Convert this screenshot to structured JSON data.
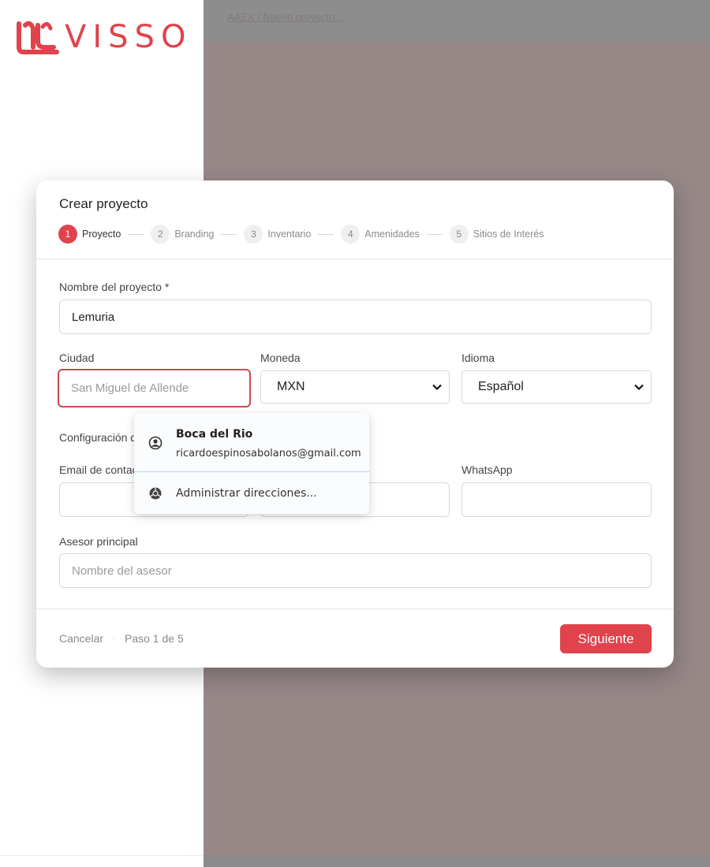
{
  "brand": {
    "name": "VISSO",
    "color": "#e0434b"
  },
  "background": {
    "breadcrumb": "AAEX / Nuevo proyecto..."
  },
  "modal": {
    "title": "Crear proyecto",
    "steps": [
      {
        "num": "1",
        "label": "Proyecto",
        "active": true
      },
      {
        "num": "2",
        "label": "Branding"
      },
      {
        "num": "3",
        "label": "Inventario"
      },
      {
        "num": "4",
        "label": "Amenidades"
      },
      {
        "num": "5",
        "label": "Sitios de Interés"
      }
    ],
    "fields": {
      "project_name": {
        "label": "Nombre del proyecto *",
        "value": "Lemuria"
      },
      "city": {
        "label": "Ciudad",
        "placeholder": "San Miguel de Allende",
        "value": ""
      },
      "currency": {
        "label": "Moneda",
        "value": "MXN"
      },
      "language": {
        "label": "Idioma",
        "value": "Español"
      },
      "config_section": {
        "label": "Configuración de"
      },
      "contact_email": {
        "label": "Email de contacto",
        "value": ""
      },
      "phone": {
        "value": ""
      },
      "whatsapp": {
        "label": "WhatsApp",
        "value": ""
      },
      "advisor": {
        "label": "Asesor principal",
        "placeholder": "Nombre del asesor",
        "value": ""
      }
    },
    "footer": {
      "cancel": "Cancelar",
      "separator": "·",
      "step_info": "Paso 1 de 5",
      "next": "Siguiente"
    }
  },
  "autofill": {
    "entry": {
      "name": "Boca del Rio",
      "email": "ricardoespinosabolanos@gmail.com",
      "icon": "account-circle-icon"
    },
    "manage": {
      "label": "Administrar direcciones...",
      "icon": "chrome-icon"
    }
  },
  "colors": {
    "accent": "#e0434b",
    "focus_border": "#c94a4f",
    "overlay": "#978888"
  }
}
